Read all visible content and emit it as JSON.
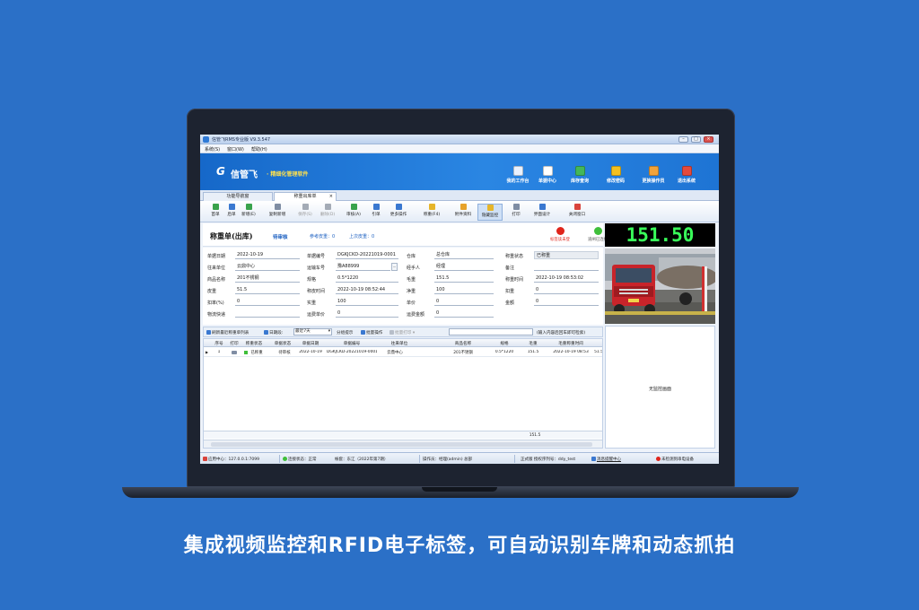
{
  "window": {
    "title": "信管飞RMS专业版 V9.3.547",
    "minimize": "–",
    "maximize": "□",
    "close": "×"
  },
  "menu": [
    "系统(S)",
    "窗口(W)",
    "帮助(H)"
  ],
  "brand": {
    "mark": "G",
    "name": "信管飞",
    "slogan": "· 精细化管理软件"
  },
  "nav": [
    {
      "label": "我的工作台",
      "icon": "monitor-icon",
      "color": "#e9f2ff"
    },
    {
      "label": "单据中心",
      "icon": "document-icon",
      "color": "#ffffff"
    },
    {
      "label": "库存查询",
      "icon": "warehouse-icon",
      "color": "#43b75a"
    },
    {
      "label": "修改密码",
      "icon": "lock-icon",
      "color": "#f4c020"
    },
    {
      "label": "更换操作员",
      "icon": "user-icon",
      "color": "#f2a33a"
    },
    {
      "label": "退出系统",
      "icon": "exit-icon",
      "color": "#e44a3c"
    }
  ],
  "tabs": [
    {
      "label": "功能导航窗",
      "active": false
    },
    {
      "label": "称重出库单",
      "active": true,
      "close": "×"
    }
  ],
  "toolbar": [
    {
      "label": "首单",
      "icon": "first-icon",
      "color": "#3aa24a"
    },
    {
      "label": "后单",
      "icon": "next-icon",
      "color": "#3a78d0"
    },
    {
      "label": "新增(E)",
      "icon": "add-icon",
      "color": "#39a34c"
    },
    {
      "label": "复制新增",
      "icon": "copy-icon",
      "color": "#7f8da3"
    },
    {
      "label": "保存(S)",
      "icon": "save-icon",
      "color": "#a4abb6",
      "disabled": true
    },
    {
      "label": "删除(D)",
      "icon": "delete-icon",
      "color": "#a4abb6",
      "disabled": true
    },
    {
      "label": "审核(A)",
      "icon": "approve-icon",
      "color": "#39a34c"
    },
    {
      "label": "引单",
      "icon": "import-icon",
      "color": "#3a78d0"
    },
    {
      "label": "更多操作",
      "icon": "more-icon",
      "color": "#3a78d0"
    },
    {
      "label": "称重(F4)",
      "icon": "scale-icon",
      "color": "#e6b52a"
    },
    {
      "label": "附件资料",
      "icon": "attachment-icon",
      "color": "#e6a22a"
    },
    {
      "label": "隐藏监控",
      "icon": "monitor-toggle-icon",
      "color": "#e6b52a",
      "highlight": true
    },
    {
      "label": "打印",
      "icon": "print-icon",
      "color": "#7f8da3"
    },
    {
      "label": "界面设计",
      "icon": "design-icon",
      "color": "#3a78d0"
    },
    {
      "label": "关闭窗口",
      "icon": "close-window-icon",
      "color": "#d9443c"
    }
  ],
  "form": {
    "title": "称重单(出库)",
    "status": "待审核",
    "ref_this": "参考皮重：0",
    "ref_last": "上次皮重：0",
    "led_left": {
      "label": "标签读未登",
      "color": "#e0251b"
    },
    "led_right": {
      "label": "道闸已连接",
      "color": "#3fbf3a"
    },
    "weight": "151.50",
    "fields": [
      [
        {
          "label": "单据日期",
          "value": "2022-10-19"
        },
        {
          "label": "单据编号",
          "value": "DGKJCKD-20221019-0001"
        },
        {
          "label": "仓库",
          "value": "总仓库"
        },
        {
          "label": "称重状态",
          "value": "已称重",
          "boxed": true
        }
      ],
      [
        {
          "label": "往来单位",
          "value": "云鼎中心"
        },
        {
          "label": "运输车号",
          "value": "豫A88999",
          "more": "..."
        },
        {
          "label": "经手人",
          "value": "经理"
        },
        {
          "label": "备注",
          "value": ""
        }
      ],
      [
        {
          "label": "商品名称",
          "value": "201不锈钢"
        },
        {
          "label": "规格",
          "value": "0.5*1220"
        },
        {
          "label": "毛重",
          "value": "151.5"
        },
        {
          "label": "称重时间",
          "value": "2022-10-19 08:53:02"
        }
      ],
      [
        {
          "label": "皮重",
          "value": "51.5"
        },
        {
          "label": "称皮时间",
          "value": "2022-10-19 08:52:44"
        },
        {
          "label": "净重",
          "value": "100"
        },
        {
          "label": "扣重",
          "value": "0"
        }
      ],
      [
        {
          "label": "扣率(%)",
          "value": "0"
        },
        {
          "label": "实重",
          "value": "100"
        },
        {
          "label": "单价",
          "value": "0"
        },
        {
          "label": "金额",
          "value": "0"
        }
      ],
      [
        {
          "label": "物流快递",
          "value": ""
        },
        {
          "label": "运费单价",
          "value": "0"
        },
        {
          "label": "运费金额",
          "value": "0"
        }
      ]
    ]
  },
  "listbar": {
    "refresh": "刷新最近称重单列表",
    "date_label": "日期段:",
    "date_value": "最近7天",
    "group": "分组提示",
    "batch": "批量操作",
    "batch_print": "批量打印",
    "hint": "(输入内容后回车即可检索)"
  },
  "grid": {
    "headers": [
      "序号",
      "打印",
      "称重状态",
      "单据状态",
      "单据日期",
      "单据编号",
      "往来单位",
      "商品名称",
      "规格",
      "毛重",
      "毛重称重时间"
    ],
    "rows": [
      [
        "1",
        "",
        "已称重",
        "待审核",
        "2022-10-19",
        "DGKJCKD-20221019-0001",
        "云鼎中心",
        "201不锈钢",
        "0.5*1220",
        "151.5",
        "2022-10-19 08:53",
        "51.5"
      ]
    ],
    "row_marker": "▶",
    "footer_total": "151.5"
  },
  "video_panel": "无监控画面",
  "status": {
    "app_center": "应用中心：127.0.0.1:7099",
    "conn": "连接状态：正常",
    "account": "帐套：东江（2022年第7期）",
    "operator": "操作员：经理(admin) 总部",
    "edition": "正式版 授权序列号：ddy_test",
    "msg": "消息提醒中心",
    "device": "未检测到串电设备"
  },
  "caption": "集成视频监控和RFID电子标签，可自动识别车牌和动态抓拍"
}
